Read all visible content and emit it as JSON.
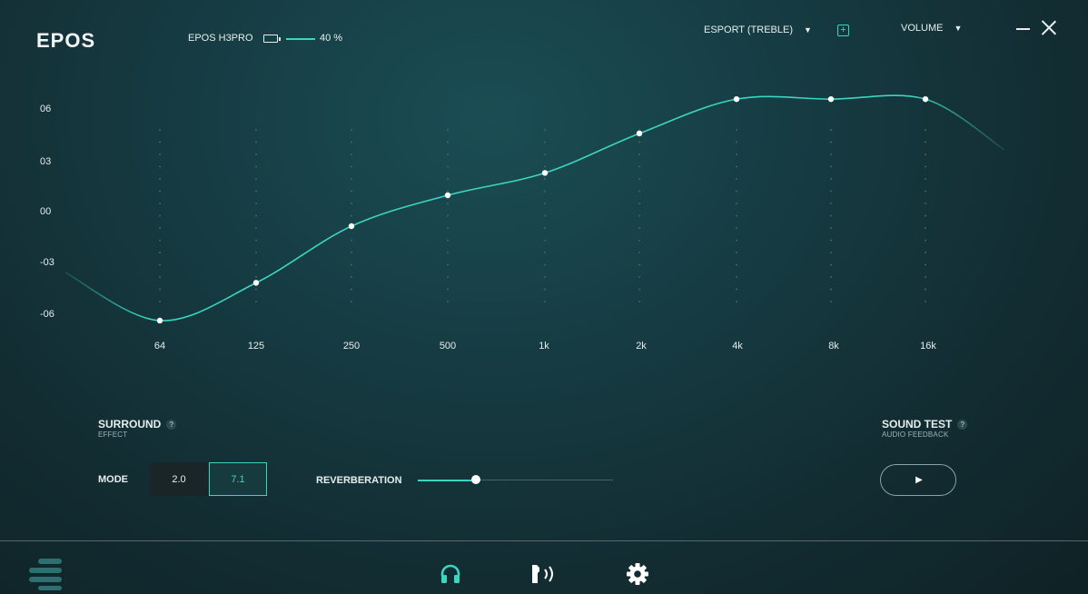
{
  "header": {
    "logo": "EPOS",
    "device_name": "EPOS H3PRO",
    "battery_percent": "40 %",
    "preset": "ESPORT (TREBLE)",
    "volume_label": "VOLUME"
  },
  "colors": {
    "accent": "#3ad6c0",
    "background": "#163c43",
    "text": "#e6eeee"
  },
  "equalizer": {
    "y_ticks": [
      "06",
      "03",
      "00",
      "-03",
      "-06"
    ],
    "x_ticks": [
      "64",
      "125",
      "250",
      "500",
      "1k",
      "2k",
      "4k",
      "8k",
      "16k"
    ]
  },
  "chart_data": {
    "type": "line",
    "categories": [
      "64",
      "125",
      "250",
      "500",
      "1k",
      "2k",
      "4k",
      "8k",
      "16k"
    ],
    "values": [
      -6.4,
      -4.2,
      -0.9,
      0.9,
      2.2,
      4.5,
      6.5,
      6.5,
      6.5
    ],
    "ylim": [
      -6,
      6
    ],
    "grid": true
  },
  "surround": {
    "title": "SURROUND",
    "subtitle": "EFFECT",
    "mode_label": "MODE",
    "modes": [
      "2.0",
      "7.1"
    ],
    "selected_mode": "7.1",
    "reverberation_label": "REVERBERATION",
    "reverberation_level": 0.3
  },
  "sound_test": {
    "title": "SOUND TEST",
    "subtitle": "AUDIO FEEDBACK"
  },
  "icons": {
    "help": "?",
    "play": "▶",
    "add": "+",
    "caret": "▾"
  },
  "nav": {
    "items": [
      "headphones-icon",
      "sidetone-icon",
      "settings-icon"
    ],
    "active": "headphones-icon"
  }
}
